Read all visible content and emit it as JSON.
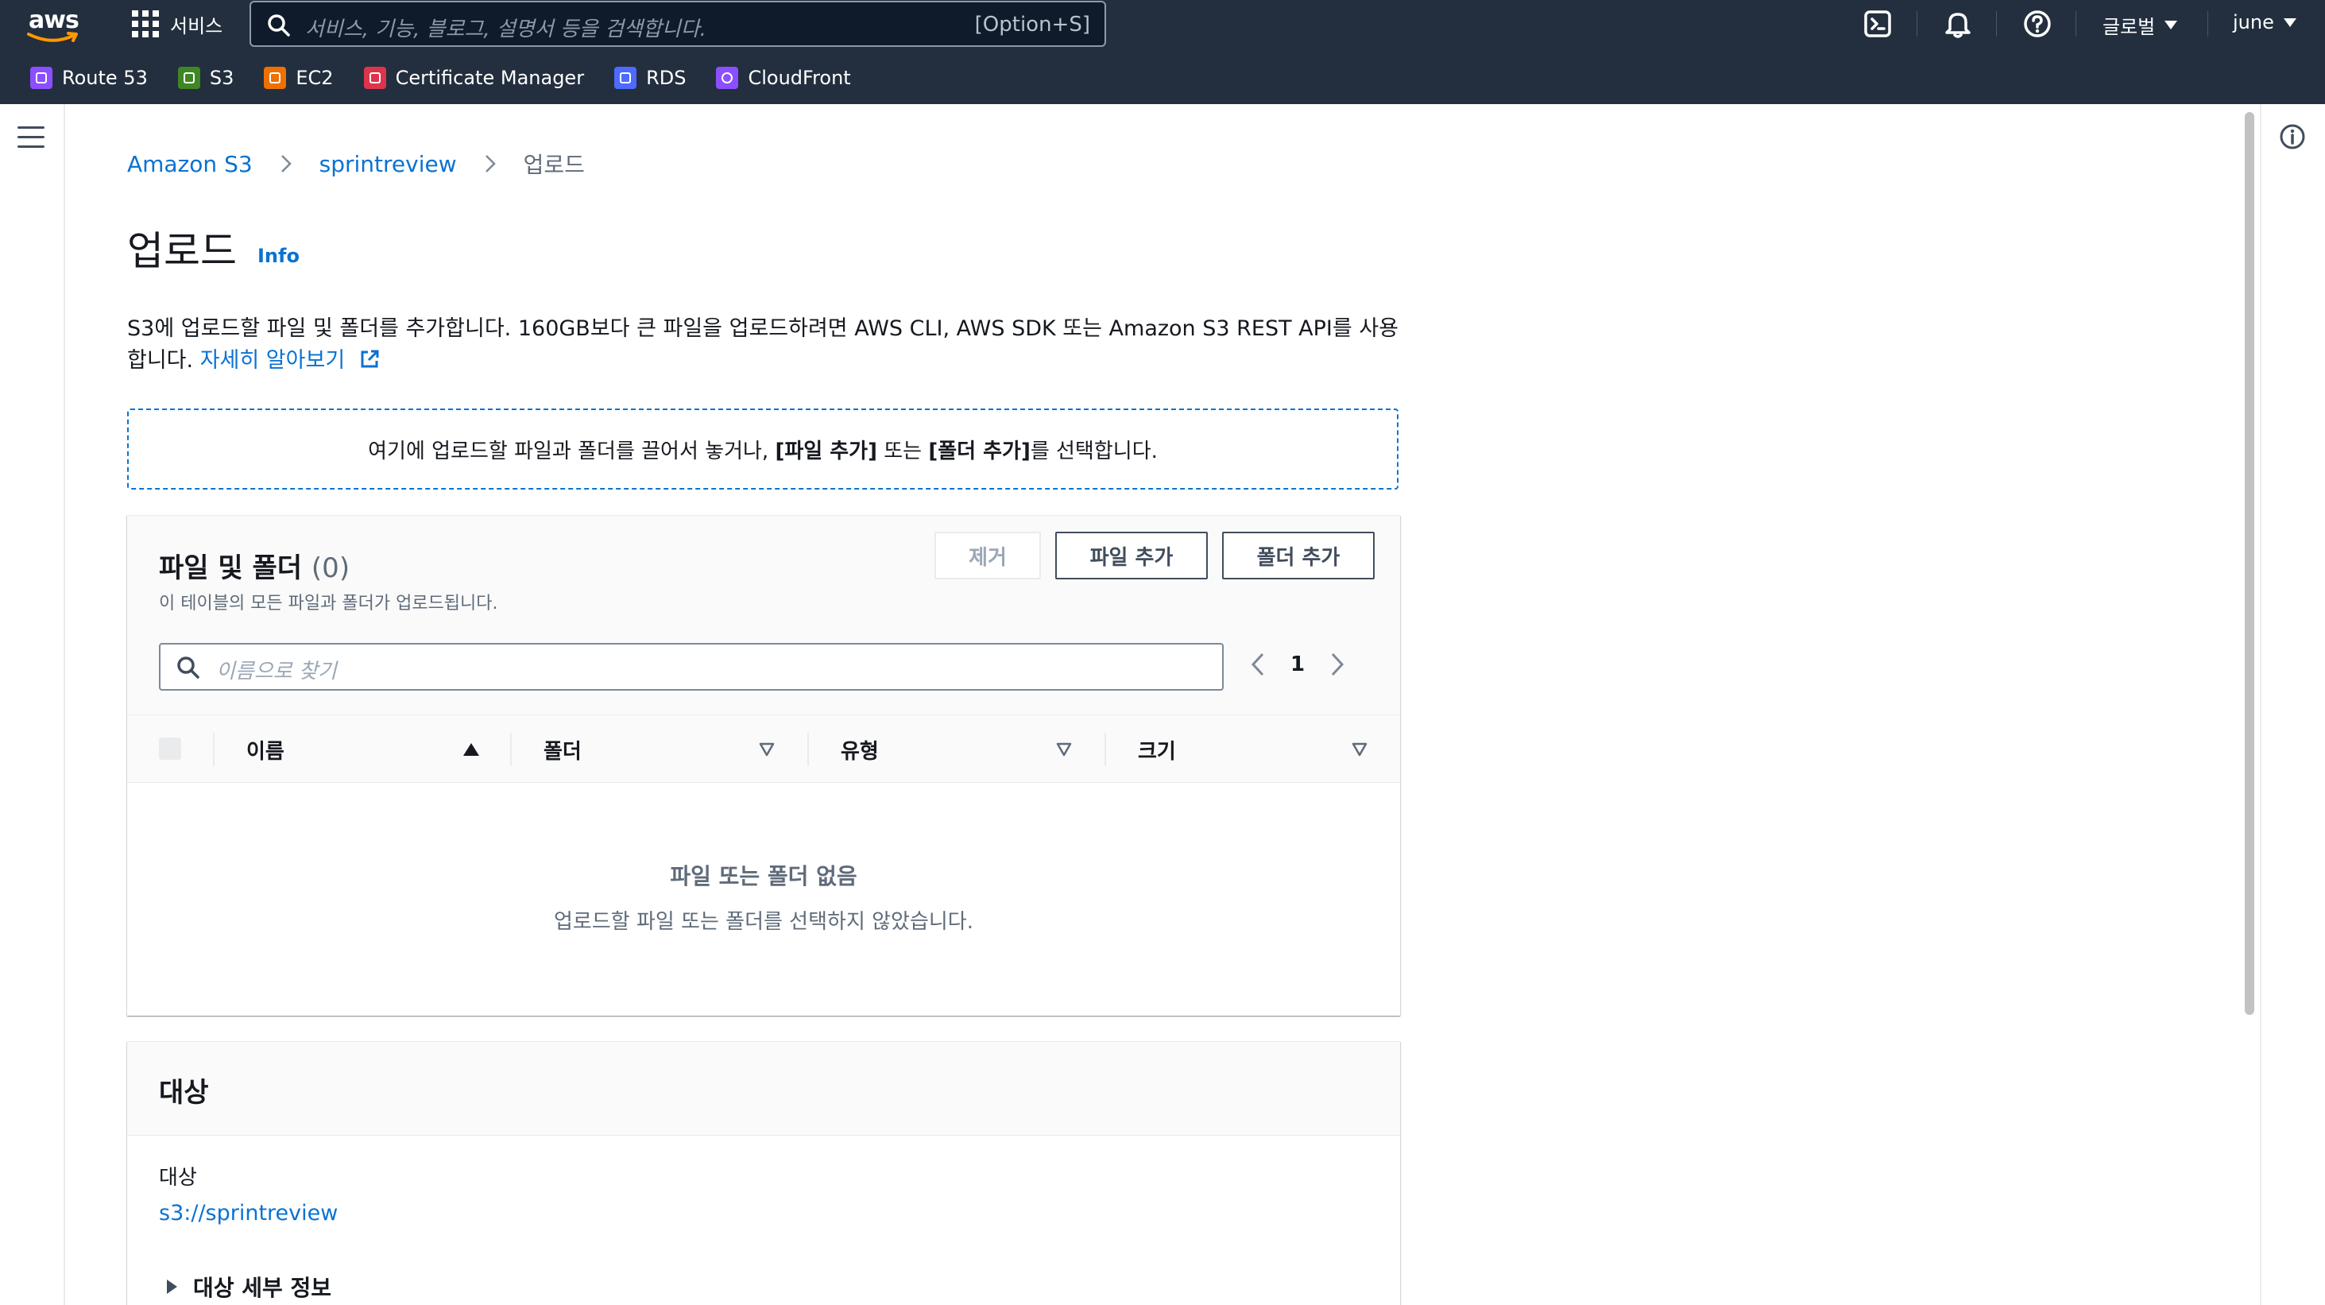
{
  "topnav": {
    "logo_text": "aws",
    "services_label": "서비스",
    "search_placeholder": "서비스, 기능, 블로그, 설명서 등을 검색합니다.",
    "search_shortcut": "[Option+S]",
    "region_label": "글로벌",
    "user_label": "june"
  },
  "favorites": [
    {
      "label": "Route 53",
      "color": "#8c4fff"
    },
    {
      "label": "S3",
      "color": "#3f8624"
    },
    {
      "label": "EC2",
      "color": "#ed7100"
    },
    {
      "label": "Certificate Manager",
      "color": "#dd344c"
    },
    {
      "label": "RDS",
      "color": "#4d6bfe"
    },
    {
      "label": "CloudFront",
      "color": "#8c4fff"
    }
  ],
  "breadcrumb": {
    "root": "Amazon S3",
    "bucket": "sprintreview",
    "current": "업로드"
  },
  "page": {
    "title": "업로드",
    "info_label": "Info",
    "description": "S3에 업로드할 파일 및 폴더를 추가합니다. 160GB보다 큰 파일을 업로드하려면 AWS CLI, AWS SDK 또는 Amazon S3 REST API를 사용합니다.",
    "learn_more": "자세히 알아보기"
  },
  "dropzone": {
    "before": "여기에 업로드할 파일과 폴더를 끌어서 놓거나, ",
    "add_files": "[파일 추가]",
    "middle": " 또는 ",
    "add_folder": "[폴더 추가]",
    "after": "를 선택합니다."
  },
  "files_panel": {
    "title": "파일 및 폴더",
    "count": "(0)",
    "subtitle": "이 테이블의 모든 파일과 폴더가 업로드됩니다.",
    "remove_button": "제거",
    "add_files_button": "파일 추가",
    "add_folder_button": "폴더 추가",
    "filter_placeholder": "이름으로 찾기",
    "page_number": "1",
    "columns": [
      "이름",
      "폴더",
      "유형",
      "크기"
    ],
    "empty_title": "파일 또는 폴더 없음",
    "empty_subtitle": "업로드할 파일 또는 폴더를 선택하지 않았습니다."
  },
  "destination_panel": {
    "title": "대상",
    "label": "대상",
    "link": "s3://sprintreview",
    "details_label": "대상 세부 정보"
  },
  "colors": {
    "nav_bg": "#232f3e",
    "link": "#0972d3",
    "text": "#16191f",
    "muted": "#5f6b7a"
  }
}
